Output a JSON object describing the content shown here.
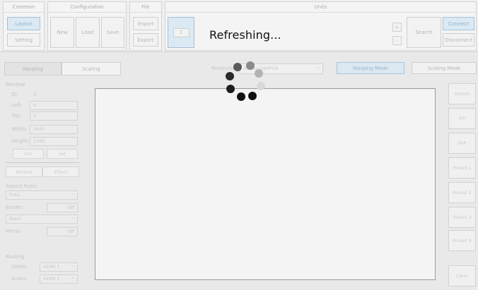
{
  "ribbon": {
    "common": {
      "label": "Common",
      "layout": "Layout",
      "setting": "Setting"
    },
    "configuration": {
      "label": "Configuration",
      "new": "New",
      "load": "Load",
      "save": "Save"
    },
    "file": {
      "label": "File",
      "import": "Import",
      "export": "Export"
    },
    "units": {
      "label": "Units",
      "unit_number": "1",
      "plus": "+",
      "minus": "-",
      "search": "Search",
      "connect": "Connect",
      "disconnect": "Disconnect"
    }
  },
  "overlay": {
    "message": "Refreshing..."
  },
  "tabs": {
    "warping": "Warping",
    "scaling": "Scaling"
  },
  "resolution": {
    "label": "Resolution",
    "value": "3840x2160P59"
  },
  "modes": {
    "warping": "Warping Mode",
    "scaling": "Scaling Mode"
  },
  "window": {
    "title": "Window",
    "id_label": "ID:",
    "id_value": "1",
    "left_label": "Left:",
    "left_value": "0",
    "top_label": "Top:",
    "top_value": "0",
    "width_label": "Width:",
    "width_value": "3840",
    "height_label": "Height:",
    "height_value": "2160",
    "get": "Get",
    "set": "Set"
  },
  "subtabs": {
    "normal": "Normal",
    "effect": "Effect"
  },
  "aspect": {
    "label": "Aspect Ratio",
    "value": "FULL"
  },
  "border": {
    "label": "Border:",
    "toggle": "Off",
    "color": "Black"
  },
  "mirror": {
    "label": "Mirror:",
    "toggle": "Off"
  },
  "routing": {
    "label": "Routing",
    "video_label": "Video:",
    "video_value": "HDMI 1",
    "audio_label": "Audio:",
    "audio_value": "HDMI 1"
  },
  "right_buttons": {
    "switch": "Switch",
    "pip": "PiP",
    "pop": "PoP",
    "preset1": "Preset 1",
    "preset2": "Preset 2",
    "preset3": "Preset 3",
    "preset4": "Preset 4",
    "clear": "Clear"
  },
  "colors": {
    "accent_blue": "#dbe9f4",
    "spinner": "#222222"
  }
}
